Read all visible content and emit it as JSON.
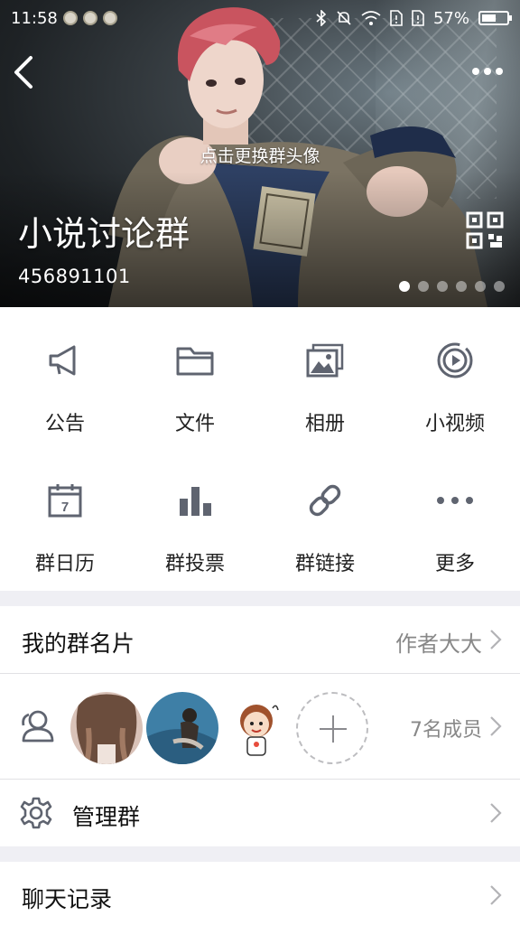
{
  "status_bar": {
    "time": "11:58",
    "battery_percent": "57%",
    "battery_level": 0.57,
    "icons": [
      "notification-icon",
      "notification-icon",
      "notification-icon",
      "bluetooth-icon",
      "mute-icon",
      "wifi-icon",
      "no-sim-icon",
      "no-sim-icon",
      "battery-icon"
    ]
  },
  "header": {
    "back_icon": "chevron-left-icon",
    "more_icon": "more-dots-icon",
    "avatar_hint": "点击更换群头像",
    "group_name": "小说讨论群",
    "group_id": "456891101",
    "qr_icon": "qr-code-icon",
    "pager_count": 6,
    "pager_active": 1
  },
  "features": [
    {
      "label": "公告",
      "icon": "megaphone-icon"
    },
    {
      "label": "文件",
      "icon": "folder-icon"
    },
    {
      "label": "相册",
      "icon": "photo-album-icon"
    },
    {
      "label": "小视频",
      "icon": "video-play-icon"
    },
    {
      "label": "群日历",
      "icon": "calendar-icon",
      "badge": "7"
    },
    {
      "label": "群投票",
      "icon": "bar-chart-icon"
    },
    {
      "label": "群链接",
      "icon": "link-icon"
    },
    {
      "label": "更多",
      "icon": "more-dots-icon"
    }
  ],
  "my_card": {
    "label": "我的群名片",
    "value": "作者大大"
  },
  "members": {
    "count_text": "7名成员",
    "icon": "members-icon",
    "add_icon": "plus-icon"
  },
  "manage": {
    "label": "管理群",
    "icon": "gear-icon"
  },
  "chat_history": {
    "label": "聊天记录"
  },
  "colors": {
    "icon_gray": "#5f6470",
    "text": "#222222",
    "secondary_text": "#888888",
    "background": "#efeff4"
  }
}
